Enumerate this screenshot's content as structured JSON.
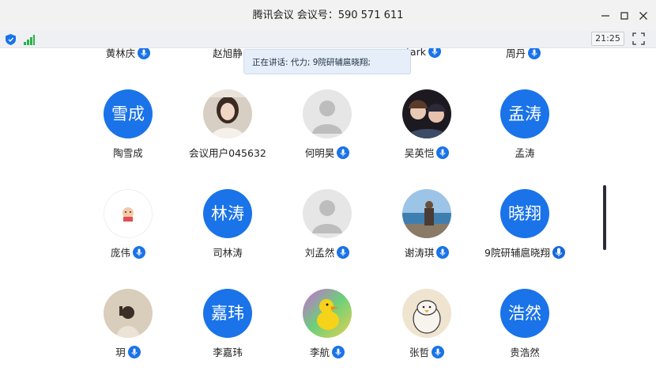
{
  "window": {
    "title": "腾讯会议 会议号：590 571 611"
  },
  "toolbar": {
    "clock": "21:25"
  },
  "speaking_tooltip": "正在讲话: 代力; 9院研辅扈晓翔;",
  "top_row": [
    {
      "name": "黄林庆",
      "mic": true
    },
    {
      "name": "赵旭静",
      "mic": false
    },
    {
      "name": "tark",
      "mic": true
    },
    {
      "name": "周丹",
      "mic": true
    }
  ],
  "participants": [
    {
      "name": "陶雪成",
      "avatar_text": "雪成",
      "avatar_type": "text",
      "mic": false
    },
    {
      "name": "会议用户045632",
      "avatar_type": "photo-woman",
      "mic": false
    },
    {
      "name": "何明昊",
      "avatar_type": "default",
      "mic": true
    },
    {
      "name": "吴英恺",
      "avatar_type": "photo-anime",
      "mic": true
    },
    {
      "name": "孟涛",
      "avatar_text": "孟涛",
      "avatar_type": "text",
      "mic": false
    },
    {
      "name": "庞伟",
      "avatar_type": "sticker",
      "mic": true
    },
    {
      "name": "司林涛",
      "avatar_text": "林涛",
      "avatar_type": "text",
      "mic": false
    },
    {
      "name": "刘孟然",
      "avatar_type": "default",
      "mic": true
    },
    {
      "name": "谢涛琪",
      "avatar_type": "photo-lake",
      "mic": true
    },
    {
      "name": "9院研辅扈晓翔",
      "avatar_text": "晓翔",
      "avatar_type": "text",
      "mic": true,
      "speaking": true
    },
    {
      "name": "玥",
      "avatar_type": "photo-girl",
      "mic": true
    },
    {
      "name": "李嘉玮",
      "avatar_text": "嘉玮",
      "avatar_type": "text",
      "mic": false
    },
    {
      "name": "李航",
      "avatar_type": "photo-duck",
      "mic": true
    },
    {
      "name": "张哲",
      "avatar_type": "photo-penguin",
      "mic": true
    },
    {
      "name": "贵浩然",
      "avatar_text": "浩然",
      "avatar_type": "text",
      "mic": false
    }
  ],
  "colors": {
    "accent": "#1a73e8",
    "titlebar": "#f2f2f2",
    "tooltip_bg": "#e6eef9"
  }
}
